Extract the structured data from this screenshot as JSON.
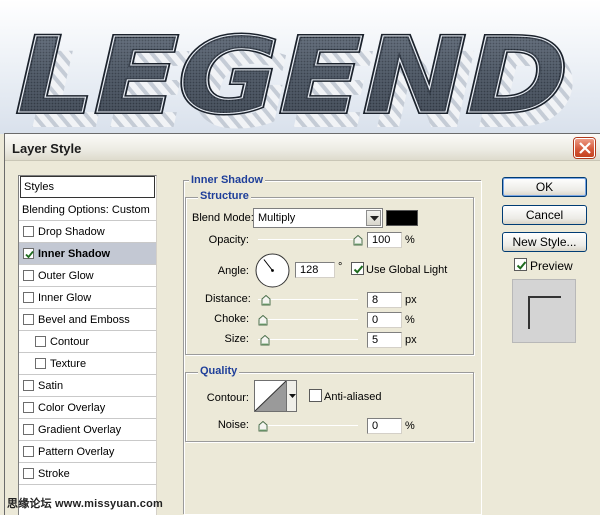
{
  "artwork": {
    "text": "LEGEND",
    "fill": "#4c5663",
    "stroke": "#1b222c"
  },
  "dialog": {
    "title": "Layer Style"
  },
  "styles_list": {
    "header": "Styles",
    "items": [
      {
        "label": "Blending Options: Custom",
        "checkbox": false,
        "checked": false,
        "selected": false,
        "indent": false
      },
      {
        "label": "Drop Shadow",
        "checkbox": true,
        "checked": false,
        "selected": false,
        "indent": false
      },
      {
        "label": "Inner Shadow",
        "checkbox": true,
        "checked": true,
        "selected": true,
        "indent": false
      },
      {
        "label": "Outer Glow",
        "checkbox": true,
        "checked": false,
        "selected": false,
        "indent": false
      },
      {
        "label": "Inner Glow",
        "checkbox": true,
        "checked": false,
        "selected": false,
        "indent": false
      },
      {
        "label": "Bevel and Emboss",
        "checkbox": true,
        "checked": false,
        "selected": false,
        "indent": false
      },
      {
        "label": "Contour",
        "checkbox": true,
        "checked": false,
        "selected": false,
        "indent": true
      },
      {
        "label": "Texture",
        "checkbox": true,
        "checked": false,
        "selected": false,
        "indent": true
      },
      {
        "label": "Satin",
        "checkbox": true,
        "checked": false,
        "selected": false,
        "indent": false
      },
      {
        "label": "Color Overlay",
        "checkbox": true,
        "checked": false,
        "selected": false,
        "indent": false
      },
      {
        "label": "Gradient Overlay",
        "checkbox": true,
        "checked": false,
        "selected": false,
        "indent": false
      },
      {
        "label": "Pattern Overlay",
        "checkbox": true,
        "checked": false,
        "selected": false,
        "indent": false
      },
      {
        "label": "Stroke",
        "checkbox": true,
        "checked": false,
        "selected": false,
        "indent": false
      }
    ]
  },
  "inner_shadow": {
    "title": "Inner Shadow",
    "structure": {
      "title": "Structure",
      "blend_mode_label": "Blend Mode:",
      "blend_mode_value": "Multiply",
      "shadow_color": "#000000",
      "opacity_label": "Opacity:",
      "opacity_value": "100",
      "opacity_unit": "%",
      "opacity_fraction": 1.0,
      "angle_label": "Angle:",
      "angle_value": "128",
      "angle_unit": "°",
      "use_global_light_label": "Use Global Light",
      "use_global_light": true,
      "distance_label": "Distance:",
      "distance_value": "8",
      "distance_unit": "px",
      "distance_fraction": 0.03,
      "choke_label": "Choke:",
      "choke_value": "0",
      "choke_unit": "%",
      "choke_fraction": 0.0,
      "size_label": "Size:",
      "size_value": "5",
      "size_unit": "px",
      "size_fraction": 0.02
    },
    "quality": {
      "title": "Quality",
      "contour_label": "Contour:",
      "anti_aliased_label": "Anti-aliased",
      "anti_aliased": false,
      "noise_label": "Noise:",
      "noise_value": "0",
      "noise_unit": "%",
      "noise_fraction": 0.0
    }
  },
  "buttons": {
    "ok": "OK",
    "cancel": "Cancel",
    "new_style": "New Style..."
  },
  "preview": {
    "label": "Preview",
    "checked": true
  },
  "watermark": "思缘论坛  www.missyuan.com",
  "colors": {
    "legend_blue": "#1f3f9a",
    "selected_row": "#c3c8d3",
    "close_red": "#d65a3c"
  }
}
